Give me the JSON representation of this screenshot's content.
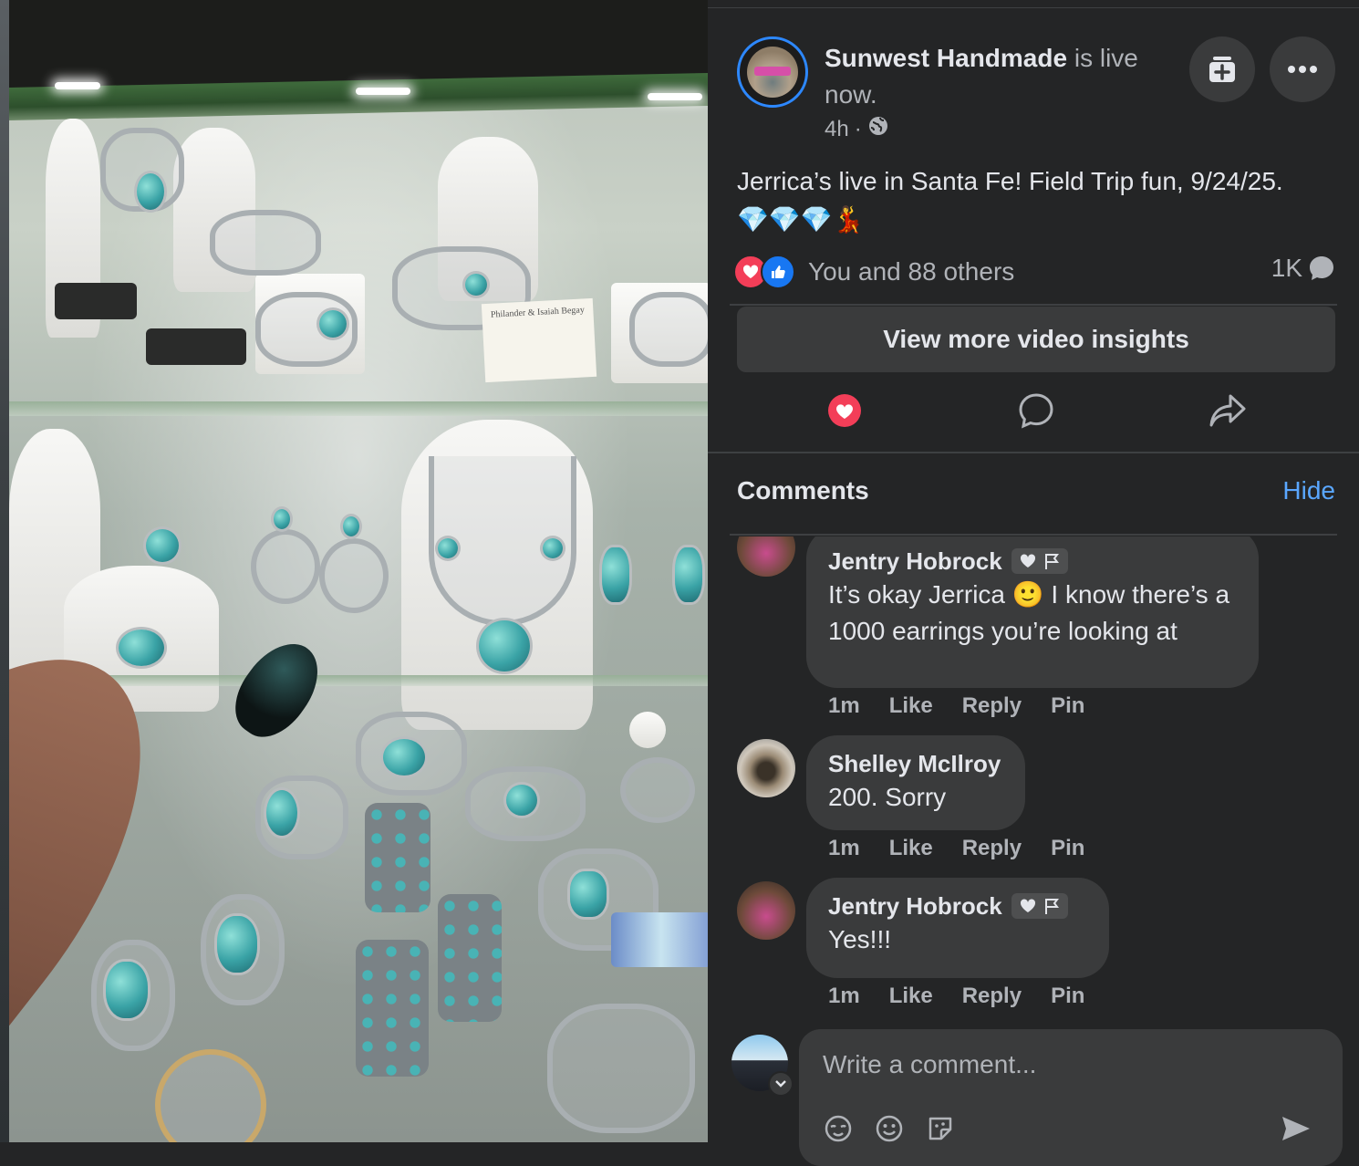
{
  "post": {
    "page_name": "Sunwest Handmade",
    "live_text": " is live now.",
    "time": "4h",
    "separator": "·",
    "audience_icon": "globe-icon",
    "caption": "Jerrica’s live in Santa Fe! Field Trip fun, 9/24/25.",
    "caption_emoji": "💎💎💎💃",
    "reactions_text": "You and 88 others",
    "comments_count": "1K",
    "insights_button": "View more video insights"
  },
  "video": {
    "sign_text": "Philander & Isaiah Begay"
  },
  "comments_section": {
    "title": "Comments",
    "hide_label": "Hide"
  },
  "comments": [
    {
      "author": "Jentry Hobrock",
      "text_before": "It’s okay Jerrica ",
      "emoji": "🙂",
      "text_after": " I know there’s a 1000 earrings you’re looking at",
      "time": "1m",
      "like": "Like",
      "reply": "Reply",
      "pin": "Pin"
    },
    {
      "author": "Shelley McIlroy",
      "text": "200. Sorry",
      "time": "1m",
      "like": "Like",
      "reply": "Reply",
      "pin": "Pin"
    },
    {
      "author": "Jentry Hobrock",
      "text": "Yes!!!",
      "time": "1m",
      "like": "Like",
      "reply": "Reply",
      "pin": "Pin"
    }
  ],
  "composer": {
    "placeholder": "Write a comment..."
  },
  "colors": {
    "panel_bg": "#242526",
    "bubble_bg": "#3a3b3c",
    "primary_text": "#e4e6eb",
    "secondary_text": "#b0b3b8",
    "link_blue": "#5aa7ff",
    "love_red": "#f33e58",
    "like_blue": "#1877f2"
  }
}
